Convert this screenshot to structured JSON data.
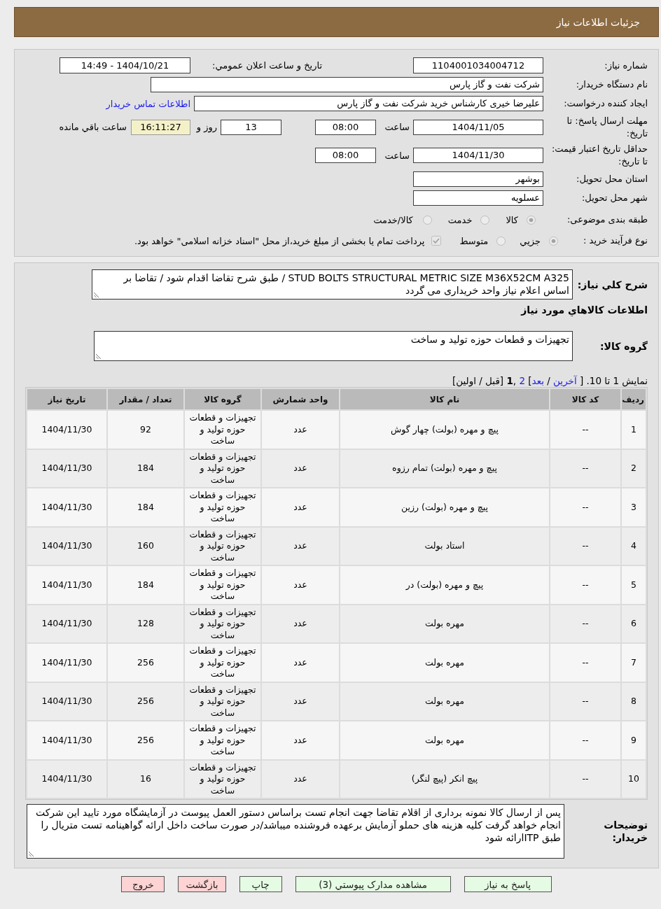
{
  "header": {
    "title": "جزئیات اطلاعات نیاز"
  },
  "details": {
    "need_number": {
      "label": "شماره نیاز:",
      "value": "1104001034004712"
    },
    "announce_datetime": {
      "label": "تاریخ و ساعت اعلان عمومي:",
      "value": "1404/10/21 - 14:49"
    },
    "buyer_org": {
      "label": "نام دستگاه خریدار:",
      "value": "شرکت نفت و گاز پارس"
    },
    "requester": {
      "label": "ایجاد کننده درخواست:",
      "value": "علیرضا  خیری کارشناس خرید  شرکت نفت و گاز پارس",
      "link": "اطلاعات تماس خریدار"
    },
    "reply_deadline": {
      "label": "مهلت ارسال پاسخ: تا تاریخ:",
      "date": "1404/11/05",
      "time_label": "ساعت",
      "time": "08:00",
      "days": "13",
      "days_label": "روز و",
      "remaining": "16:11:27",
      "remaining_label": "ساعت باقي مانده"
    },
    "price_validity": {
      "label": "حداقل تاریخ اعتبار قیمت: تا تاریخ:",
      "date": "1404/11/30",
      "time_label": "ساعت",
      "time": "08:00"
    },
    "province": {
      "label": "استان محل تحویل:",
      "value": "بوشهر"
    },
    "city": {
      "label": "شهر محل تحویل:",
      "value": "عسلویه"
    },
    "category": {
      "label": "طبقه بندی موضوعی:",
      "options": [
        {
          "label": "کالا",
          "selected": true,
          "disabled": true
        },
        {
          "label": "خدمت",
          "selected": false,
          "disabled": true
        },
        {
          "label": "کالا/خدمت",
          "selected": false,
          "disabled": true
        }
      ]
    },
    "process": {
      "label": "نوع فرآیند خرید :",
      "options": [
        {
          "label": "جزيي",
          "selected": true,
          "disabled": true
        },
        {
          "label": "متوسط",
          "selected": false,
          "disabled": true
        }
      ],
      "treasury": {
        "label": "پرداخت تمام یا بخشی از مبلغ خرید،از محل \"اسناد خزانه اسلامی\" خواهد بود.",
        "checked": true,
        "disabled": true
      }
    }
  },
  "summary": {
    "label": "شرح کلي نیاز:",
    "value": "STUD BOLTS STRUCTURAL METRIC SIZE M36X52CM A325  /  طبق شرح تقاضا اقدام شود / تقاضا بر اساس اعلام نیاز واحد خریداری می گردد"
  },
  "goods_title": "اطلاعات کالاهاي مورد نیاز",
  "goods_group": {
    "label": "گروه کالا:",
    "value": "تجهیزات و قطعات حوزه تولید و ساخت"
  },
  "pagination": [
    {
      "kind": "text",
      "text": "نمایش 1 تا 10. [ "
    },
    {
      "kind": "link",
      "text": "آخرین"
    },
    {
      "kind": "text",
      "text": " / "
    },
    {
      "kind": "link",
      "text": "بعد"
    },
    {
      "kind": "text",
      "text": "] "
    },
    {
      "kind": "link",
      "text": "2"
    },
    {
      "kind": "text",
      "text": " ,"
    },
    {
      "kind": "current",
      "text": "1"
    },
    {
      "kind": "text",
      "text": " [قبل / اولین]"
    }
  ],
  "table": {
    "columns": [
      "ردیف",
      "کد کالا",
      "نام کالا",
      "واحد شمارش",
      "گروه کالا",
      "تعداد / مقدار",
      "تاریخ نیاز"
    ],
    "rows": [
      {
        "row": "1",
        "code": "--",
        "name": "پیچ و مهره (بولت) چهار گوش",
        "unit": "عدد",
        "group": "تجهیزات و قطعات حوزه تولید و ساخت",
        "quantity": "92",
        "date": "1404/11/30"
      },
      {
        "row": "2",
        "code": "--",
        "name": "پیچ و مهره (بولت) تمام رزوه",
        "unit": "عدد",
        "group": "تجهیزات و قطعات حوزه تولید و ساخت",
        "quantity": "184",
        "date": "1404/11/30"
      },
      {
        "row": "3",
        "code": "--",
        "name": "پیچ و مهره (بولت) رزین",
        "unit": "عدد",
        "group": "تجهیزات و قطعات حوزه تولید و ساخت",
        "quantity": "184",
        "date": "1404/11/30"
      },
      {
        "row": "4",
        "code": "--",
        "name": "استاد بولت",
        "unit": "عدد",
        "group": "تجهیزات و قطعات حوزه تولید و ساخت",
        "quantity": "160",
        "date": "1404/11/30"
      },
      {
        "row": "5",
        "code": "--",
        "name": "پیچ و مهره (بولت) در",
        "unit": "عدد",
        "group": "تجهیزات و قطعات حوزه تولید و ساخت",
        "quantity": "184",
        "date": "1404/11/30"
      },
      {
        "row": "6",
        "code": "--",
        "name": "مهره بولت",
        "unit": "عدد",
        "group": "تجهیزات و قطعات حوزه تولید و ساخت",
        "quantity": "128",
        "date": "1404/11/30"
      },
      {
        "row": "7",
        "code": "--",
        "name": "مهره بولت",
        "unit": "عدد",
        "group": "تجهیزات و قطعات حوزه تولید و ساخت",
        "quantity": "256",
        "date": "1404/11/30"
      },
      {
        "row": "8",
        "code": "--",
        "name": "مهره بولت",
        "unit": "عدد",
        "group": "تجهیزات و قطعات حوزه تولید و ساخت",
        "quantity": "256",
        "date": "1404/11/30"
      },
      {
        "row": "9",
        "code": "--",
        "name": "مهره بولت",
        "unit": "عدد",
        "group": "تجهیزات و قطعات حوزه تولید و ساخت",
        "quantity": "256",
        "date": "1404/11/30"
      },
      {
        "row": "10",
        "code": "--",
        "name": "پیچ انکر (پیچ لنگر)",
        "unit": "عدد",
        "group": "تجهیزات و قطعات حوزه تولید و ساخت",
        "quantity": "16",
        "date": "1404/11/30"
      }
    ]
  },
  "buyer_notes": {
    "label": "توضیحات خریدار:",
    "value": "پس از ارسال کالا نمونه برداری از اقلام تقاضا جهت انجام تست براساس دستور العمل پیوست در آزمایشگاه مورد تایید این شرکت انجام خواهد گرفت کلیه هزینه های حملو آزمایش برعهده فروشنده میباشد/در صورت ساخت داخل ارائه گواهینامه تست متریال را طبق ITPارائه شود"
  },
  "buttons": [
    {
      "label": "پاسخ به نیاز",
      "kind": "normal"
    },
    {
      "label": "مشاهده مدارک پیوستي (3)",
      "kind": "normal"
    },
    {
      "label": "چاپ",
      "kind": "normal"
    },
    {
      "label": "بازگشت",
      "kind": "danger"
    },
    {
      "label": "خروج",
      "kind": "danger"
    }
  ]
}
